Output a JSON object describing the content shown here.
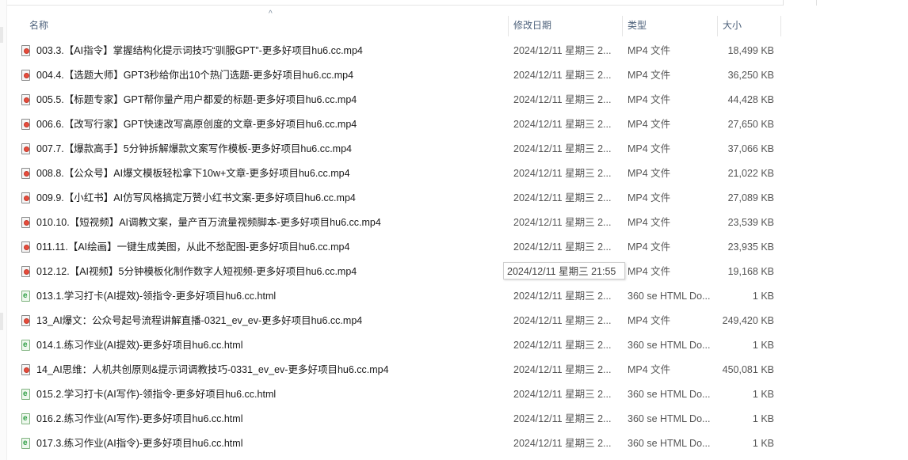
{
  "columns": {
    "name": "名称",
    "date": "修改日期",
    "type": "类型",
    "size": "大小"
  },
  "sort_arrow": "^",
  "tooltip": "2024/12/11 星期三 21:55",
  "files": [
    {
      "icon": "mp4-file-icon",
      "name": "003.3.【AI指令】掌握结构化提示词技巧“驯服GPT”-更多好项目hu6.cc.mp4",
      "date": "2024/12/11 星期三 2...",
      "type": "MP4 文件",
      "size": "18,499 KB"
    },
    {
      "icon": "mp4-file-icon",
      "name": "004.4.【选题大师】GPT3秒给你出10个热门选题-更多好项目hu6.cc.mp4",
      "date": "2024/12/11 星期三 2...",
      "type": "MP4 文件",
      "size": "36,250 KB"
    },
    {
      "icon": "mp4-file-icon",
      "name": "005.5.【标题专家】GPT帮你量产用户都爱的标题-更多好项目hu6.cc.mp4",
      "date": "2024/12/11 星期三 2...",
      "type": "MP4 文件",
      "size": "44,428 KB"
    },
    {
      "icon": "mp4-file-icon",
      "name": "006.6.【改写行家】GPT快速改写高原创度的文章-更多好项目hu6.cc.mp4",
      "date": "2024/12/11 星期三 2...",
      "type": "MP4 文件",
      "size": "27,650 KB"
    },
    {
      "icon": "mp4-file-icon",
      "name": "007.7.【爆款高手】5分钟拆解爆款文案写作模板-更多好项目hu6.cc.mp4",
      "date": "2024/12/11 星期三 2...",
      "type": "MP4 文件",
      "size": "37,066 KB"
    },
    {
      "icon": "mp4-file-icon",
      "name": "008.8.【公众号】AI爆文模板轻松拿下10w+文章-更多好项目hu6.cc.mp4",
      "date": "2024/12/11 星期三 2...",
      "type": "MP4 文件",
      "size": "21,022 KB"
    },
    {
      "icon": "mp4-file-icon",
      "name": "009.9.【小红书】AI仿写风格搞定万赞小红书文案-更多好项目hu6.cc.mp4",
      "date": "2024/12/11 星期三 2...",
      "type": "MP4 文件",
      "size": "27,089 KB"
    },
    {
      "icon": "mp4-file-icon",
      "name": "010.10.【短视频】AI调教文案，量产百万流量视频脚本-更多好项目hu6.cc.mp4",
      "date": "2024/12/11 星期三 2...",
      "type": "MP4 文件",
      "size": "23,539 KB"
    },
    {
      "icon": "mp4-file-icon",
      "name": "011.11.【AI绘画】一键生成美图，从此不愁配图-更多好项目hu6.cc.mp4",
      "date": "2024/12/11 星期三 2...",
      "type": "MP4 文件",
      "size": "23,935 KB"
    },
    {
      "icon": "mp4-file-icon",
      "name": "012.12.【AI视频】5分钟模板化制作数字人短视频-更多好项目hu6.cc.mp4",
      "date": "2024/12/11 星期三 2...",
      "type": "MP4 文件",
      "size": "19,168 KB"
    },
    {
      "icon": "html-file-icon",
      "name": "013.1.学习打卡(AI提效)-领指令-更多好项目hu6.cc.html",
      "date": "2024/12/11 星期三 2...",
      "type": "360 se HTML Do...",
      "size": "1 KB"
    },
    {
      "icon": "mp4-file-icon",
      "name": "13_AI爆文：公众号起号流程讲解直播-0321_ev_ev-更多好项目hu6.cc.mp4",
      "date": "2024/12/11 星期三 2...",
      "type": "MP4 文件",
      "size": "249,420 KB"
    },
    {
      "icon": "html-file-icon",
      "name": "014.1.练习作业(AI提效)-更多好项目hu6.cc.html",
      "date": "2024/12/11 星期三 2...",
      "type": "360 se HTML Do...",
      "size": "1 KB"
    },
    {
      "icon": "mp4-file-icon",
      "name": "14_AI思维：人机共创原则&提示词调教技巧-0331_ev_ev-更多好项目hu6.cc.mp4",
      "date": "2024/12/11 星期三 2...",
      "type": "MP4 文件",
      "size": "450,081 KB"
    },
    {
      "icon": "html-file-icon",
      "name": "015.2.学习打卡(AI写作)-领指令-更多好项目hu6.cc.html",
      "date": "2024/12/11 星期三 2...",
      "type": "360 se HTML Do...",
      "size": "1 KB"
    },
    {
      "icon": "html-file-icon",
      "name": "016.2.练习作业(AI写作)-更多好项目hu6.cc.html",
      "date": "2024/12/11 星期三 2...",
      "type": "360 se HTML Do...",
      "size": "1 KB"
    },
    {
      "icon": "html-file-icon",
      "name": "017.3.练习作业(AI指令)-更多好项目hu6.cc.html",
      "date": "2024/12/11 星期三 2...",
      "type": "360 se HTML Do...",
      "size": "1 KB"
    }
  ]
}
